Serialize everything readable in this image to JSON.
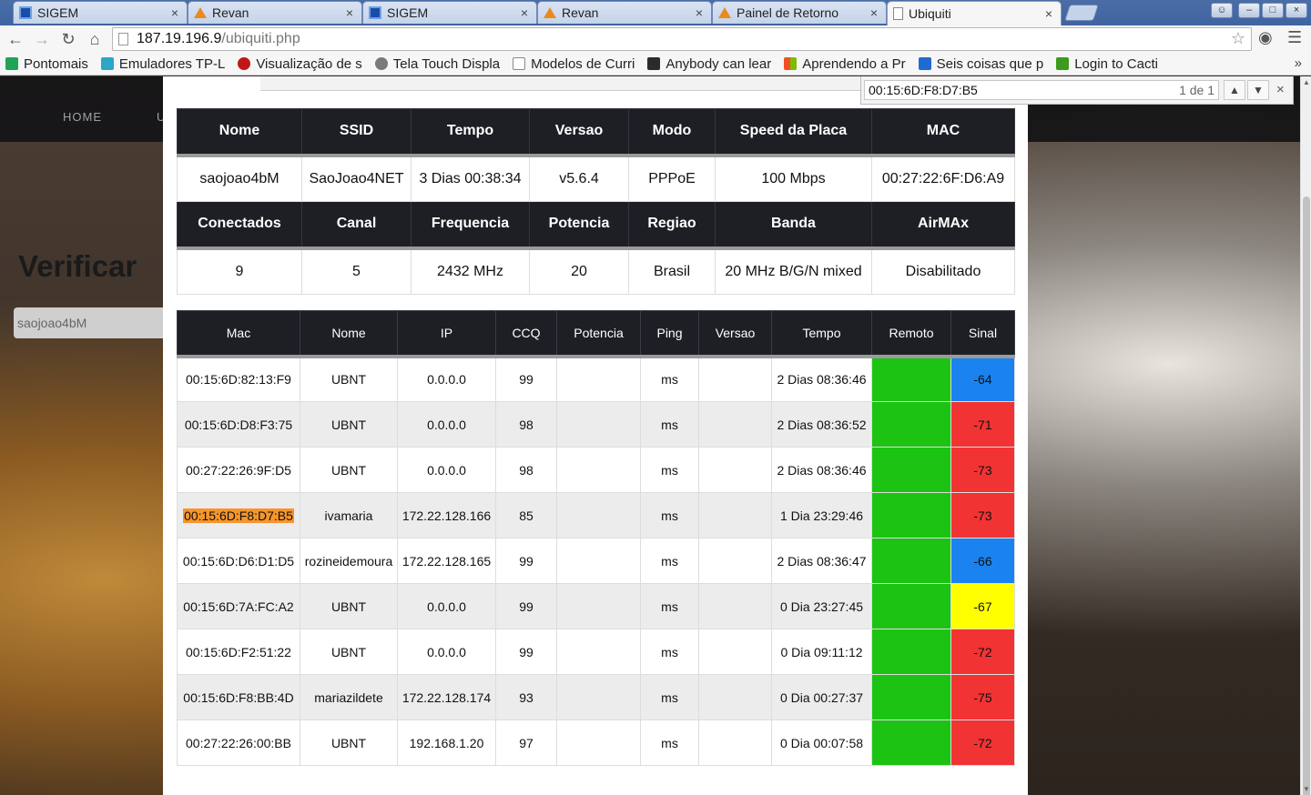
{
  "browser": {
    "tabs": [
      {
        "label": "SIGEM",
        "icon": "sigem-icon"
      },
      {
        "label": "Revan",
        "icon": "revan-icon"
      },
      {
        "label": "SIGEM",
        "icon": "sigem-icon"
      },
      {
        "label": "Revan",
        "icon": "revan-icon"
      },
      {
        "label": "Painel de Retorno",
        "icon": "revan-icon"
      },
      {
        "label": "Ubiquiti",
        "icon": "page-icon",
        "active": true
      }
    ],
    "tab_close": "×",
    "url_host": "187.19.196.9",
    "url_path": "/ubiquiti.php",
    "bookmarks": [
      {
        "label": "Pontomais",
        "color": "#1fa35a"
      },
      {
        "label": "Emuladores TP-L",
        "color": "#2aa7c9"
      },
      {
        "label": "Visualização de s",
        "color": "#c01818"
      },
      {
        "label": "Tela Touch Displa",
        "color": "#7a7a7a"
      },
      {
        "label": "Modelos de Curri",
        "color": "#ffffff"
      },
      {
        "label": "Anybody can lear",
        "color": "#2b2b2b"
      },
      {
        "label": "Aprendendo a Pr",
        "color": "#2f8ee6"
      },
      {
        "label": "Seis coisas que p",
        "color": "#1f6bd0"
      },
      {
        "label": "Login to Cacti",
        "color": "#3d9a1e"
      }
    ],
    "bookmarks_more": "»"
  },
  "find": {
    "query": "00:15:6D:F8:D7:B5",
    "count": "1 de 1",
    "up": "▲",
    "down": "▼",
    "close": "×"
  },
  "site": {
    "menu_home": "HOME",
    "menu_partial": "U",
    "title": "Verificar",
    "search_value": "saojoao4bM"
  },
  "info": {
    "row1_headers": [
      "Nome",
      "SSID",
      "Tempo",
      "Versao",
      "Modo",
      "Speed da Placa",
      "MAC"
    ],
    "row1_values": [
      "saojoao4bM",
      "SaoJoao4NET",
      "3 Dias 00:38:34",
      "v5.6.4",
      "PPPoE",
      "100 Mbps",
      "00:27:22:6F:D6:A9"
    ],
    "row2_headers": [
      "Conectados",
      "Canal",
      "Frequencia",
      "Potencia",
      "Regiao",
      "Banda",
      "AirMAx"
    ],
    "row2_values": [
      "9",
      "5",
      "2432 MHz",
      "20",
      "Brasil",
      "20 MHz B/G/N mixed",
      "Disabilitado"
    ]
  },
  "clients": {
    "headers": [
      "Mac",
      "Nome",
      "IP",
      "CCQ",
      "Potencia",
      "Ping",
      "Versao",
      "Tempo",
      "Remoto",
      "Sinal"
    ],
    "rows": [
      {
        "mac": "00:15:6D:82:13:F9",
        "nome": "UBNT",
        "ip": "0.0.0.0",
        "ccq": "99",
        "potencia": "",
        "ping": "ms",
        "versao": "",
        "tempo": "2 Dias 08:36:46",
        "sinal": "-64",
        "sinal_color": "blue"
      },
      {
        "mac": "00:15:6D:D8:F3:75",
        "nome": "UBNT",
        "ip": "0.0.0.0",
        "ccq": "98",
        "potencia": "",
        "ping": "ms",
        "versao": "",
        "tempo": "2 Dias 08:36:52",
        "sinal": "-71",
        "sinal_color": "red"
      },
      {
        "mac": "00:27:22:26:9F:D5",
        "nome": "UBNT",
        "ip": "0.0.0.0",
        "ccq": "98",
        "potencia": "",
        "ping": "ms",
        "versao": "",
        "tempo": "2 Dias 08:36:46",
        "sinal": "-73",
        "sinal_color": "red"
      },
      {
        "mac": "00:15:6D:F8:D7:B5",
        "nome": "ivamaria",
        "ip": "172.22.128.166",
        "ccq": "85",
        "potencia": "",
        "ping": "ms",
        "versao": "",
        "tempo": "1 Dia 23:29:46",
        "sinal": "-73",
        "sinal_color": "red",
        "highlight": true
      },
      {
        "mac": "00:15:6D:D6:D1:D5",
        "nome": "rozineidemoura",
        "ip": "172.22.128.165",
        "ccq": "99",
        "potencia": "",
        "ping": "ms",
        "versao": "",
        "tempo": "2 Dias 08:36:47",
        "sinal": "-66",
        "sinal_color": "blue"
      },
      {
        "mac": "00:15:6D:7A:FC:A2",
        "nome": "UBNT",
        "ip": "0.0.0.0",
        "ccq": "99",
        "potencia": "",
        "ping": "ms",
        "versao": "",
        "tempo": "0 Dia 23:27:45",
        "sinal": "-67",
        "sinal_color": "yellow"
      },
      {
        "mac": "00:15:6D:F2:51:22",
        "nome": "UBNT",
        "ip": "0.0.0.0",
        "ccq": "99",
        "potencia": "",
        "ping": "ms",
        "versao": "",
        "tempo": "0 Dia 09:11:12",
        "sinal": "-72",
        "sinal_color": "red"
      },
      {
        "mac": "00:15:6D:F8:BB:4D",
        "nome": "mariazildete",
        "ip": "172.22.128.174",
        "ccq": "93",
        "potencia": "",
        "ping": "ms",
        "versao": "",
        "tempo": "0 Dia 00:27:37",
        "sinal": "-75",
        "sinal_color": "red"
      },
      {
        "mac": "00:27:22:26:00:BB",
        "nome": "UBNT",
        "ip": "192.168.1.20",
        "ccq": "97",
        "potencia": "",
        "ping": "ms",
        "versao": "",
        "tempo": "0 Dia 00:07:58",
        "sinal": "-72",
        "sinal_color": "red"
      }
    ]
  },
  "colors": {
    "remoto": "#1cc313",
    "signal_blue": "#1a83f0",
    "signal_red": "#f23333",
    "signal_yellow": "#ffff00",
    "find_highlight": "#f7952a",
    "header_bg": "#1d1f24"
  }
}
